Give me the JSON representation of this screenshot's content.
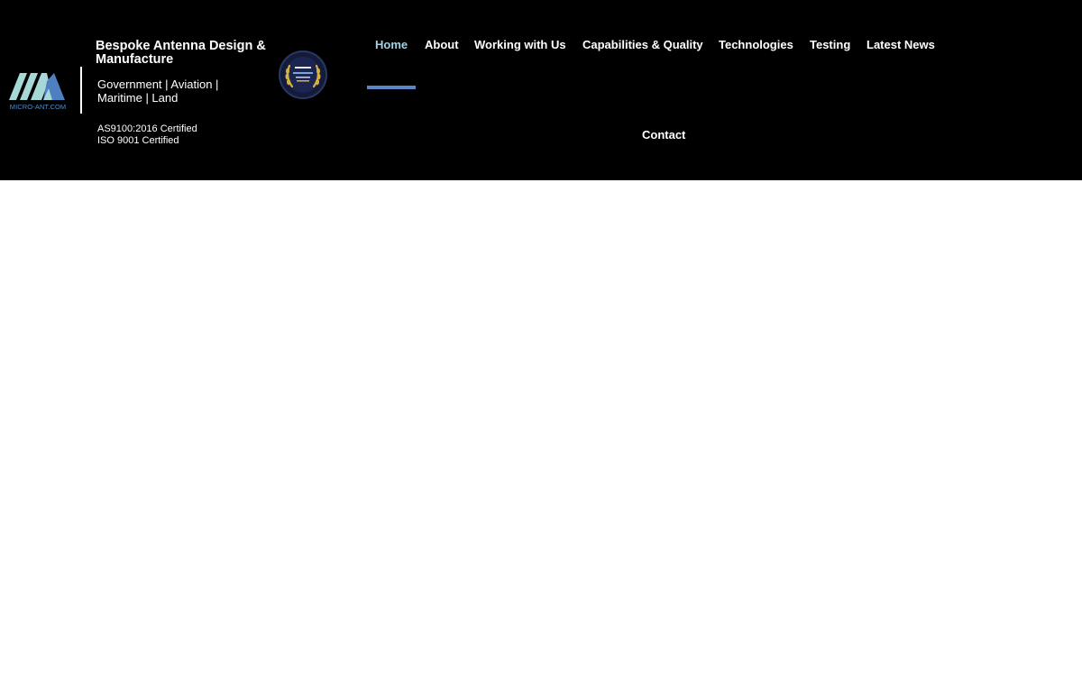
{
  "brand": {
    "logo_text": "MICRO-ANT.COM",
    "tagline": "Bespoke Antenna Design & Manufacture",
    "sectors": "Government | Aviation | Maritime | Land",
    "certifications": [
      "AS9100:2016 Certified",
      "ISO 9001 Certified"
    ],
    "badge_icon": "award-laurel-badge-icon"
  },
  "nav": {
    "items": [
      {
        "label": "Home",
        "active": true
      },
      {
        "label": "About"
      },
      {
        "label": "Working with Us"
      },
      {
        "label": "Capabilities & Quality"
      },
      {
        "label": "Technologies"
      },
      {
        "label": "Testing"
      },
      {
        "label": "Latest News"
      }
    ],
    "contact": "Contact"
  },
  "colors": {
    "header_bg": "#000000",
    "page_bg": "#ffffff",
    "nav_text": "#ffffff",
    "nav_active": "#9fd3e6",
    "active_underline": "#5b84c4",
    "logo_light": "#a6d8d8",
    "logo_blue": "#4f7fc0"
  }
}
